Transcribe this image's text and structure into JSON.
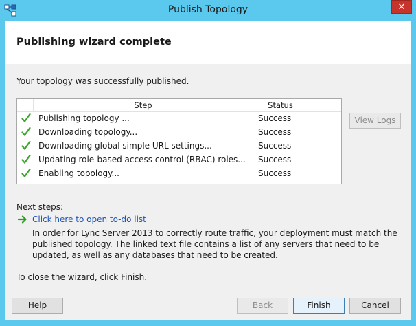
{
  "window": {
    "title": "Publish Topology",
    "close_glyph": "✕"
  },
  "header": {
    "title": "Publishing wizard complete"
  },
  "success_message": "Your topology was successfully published.",
  "table": {
    "columns": [
      "Step",
      "Status"
    ],
    "rows": [
      {
        "step": "Publishing topology ...",
        "status": "Success"
      },
      {
        "step": "Downloading topology...",
        "status": "Success"
      },
      {
        "step": "Downloading global simple URL settings...",
        "status": "Success"
      },
      {
        "step": "Updating role-based access control (RBAC) roles...",
        "status": "Success"
      },
      {
        "step": "Enabling topology...",
        "status": "Success"
      }
    ]
  },
  "view_logs_label": "View Logs",
  "next_steps": {
    "label": "Next steps:",
    "link": "Click here to open to-do list",
    "description": "In order for Lync Server 2013 to correctly route traffic, your deployment must match the published topology. The linked text file contains a list of any servers that need to be updated, as well as any databases that need to be created."
  },
  "close_hint": "To close the wizard, click Finish.",
  "buttons": {
    "help": "Help",
    "back": "Back",
    "finish": "Finish",
    "cancel": "Cancel"
  },
  "colors": {
    "accent": "#5bc8ed",
    "close": "#c7342b",
    "link": "#1c56b8",
    "check": "#3aa62c",
    "arrow": "#2f9b27"
  }
}
